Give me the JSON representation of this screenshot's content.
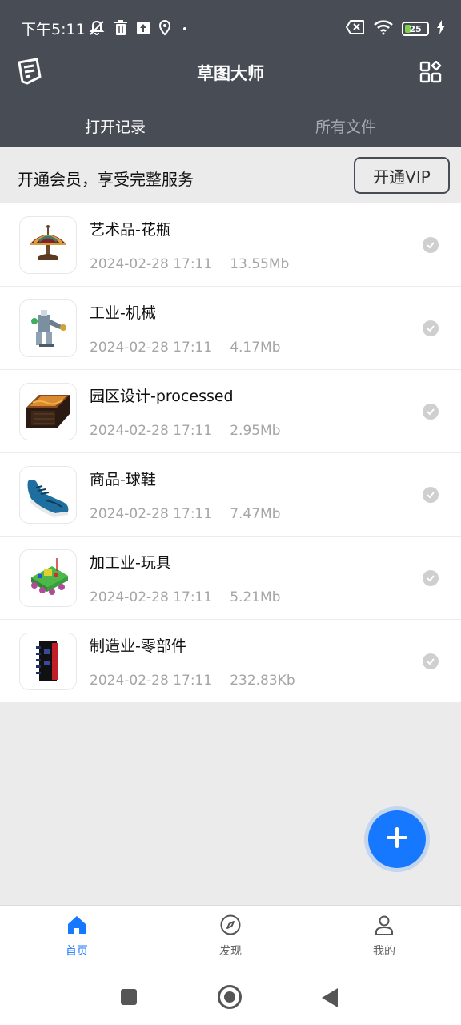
{
  "status_bar": {
    "time": "下午5:11",
    "battery": "25",
    "battery_level": 0.25,
    "icons_left": [
      "notifications-muted-icon",
      "trash-icon",
      "upload-icon",
      "location-icon",
      "dot-icon"
    ],
    "icons_right": [
      "no-sim-icon",
      "wifi-icon",
      "battery-icon",
      "charging-icon"
    ]
  },
  "app": {
    "title": "草图大师",
    "logo_icon": "sketch-logo-icon",
    "menu_icon": "apps-grid-icon"
  },
  "tabs": [
    {
      "label": "打开记录",
      "active": true
    },
    {
      "label": "所有文件",
      "active": false
    }
  ],
  "vip": {
    "text": "开通会员，享受完整服务",
    "button": "开通VIP"
  },
  "files": [
    {
      "name": "艺术品-花瓶",
      "date": "2024-02-28 17:11",
      "size": "13.55Mb",
      "thumb": "lamp-model-thumbnail"
    },
    {
      "name": "工业-机械",
      "date": "2024-02-28 17:11",
      "size": "4.17Mb",
      "thumb": "machine-model-thumbnail"
    },
    {
      "name": "园区设计-processed",
      "date": "2024-02-28 17:11",
      "size": "2.95Mb",
      "thumb": "park-model-thumbnail"
    },
    {
      "name": "商品-球鞋",
      "date": "2024-02-28 17:11",
      "size": "7.47Mb",
      "thumb": "sneaker-model-thumbnail"
    },
    {
      "name": "加工业-玩具",
      "date": "2024-02-28 17:11",
      "size": "5.21Mb",
      "thumb": "toy-model-thumbnail"
    },
    {
      "name": "制造业-零部件",
      "date": "2024-02-28 17:11",
      "size": "232.83Kb",
      "thumb": "parts-model-thumbnail"
    }
  ],
  "fab": {
    "icon": "plus-icon"
  },
  "bottom_nav": [
    {
      "label": "首页",
      "icon": "home-icon",
      "active": true
    },
    {
      "label": "发现",
      "icon": "compass-icon",
      "active": false
    },
    {
      "label": "我的",
      "icon": "user-icon",
      "active": false
    }
  ],
  "colors": {
    "header": "#474c55",
    "accent": "#1677ff",
    "background": "#ebebeb",
    "battery_fill": "#7fd14b"
  }
}
